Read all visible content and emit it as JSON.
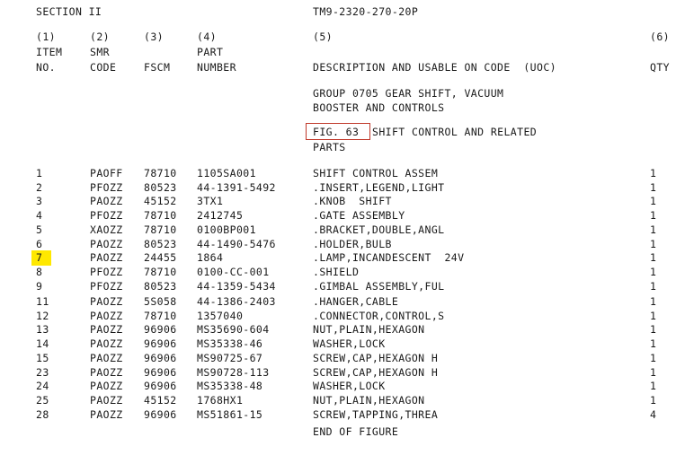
{
  "document": {
    "section_label": "SECTION II",
    "manual_number": "TM9-2320-270-20P"
  },
  "columns": {
    "numbers": [
      "(1)",
      "(2)",
      "(3)",
      "(4)",
      "(5)",
      "(6)"
    ],
    "item_line1": "ITEM",
    "item_line2": "NO.",
    "smr_line1": "SMR",
    "smr_line2": "CODE",
    "fscm": "FSCM",
    "part_line1": "PART",
    "part_line2": "NUMBER",
    "description": "DESCRIPTION AND USABLE ON CODE  (UOC)",
    "qty": "QTY"
  },
  "group": {
    "line1": "GROUP 0705 GEAR SHIFT, VACUUM",
    "line2": "BOOSTER AND CONTROLS"
  },
  "figure": {
    "label": "FIG. 63",
    "title_line1": "SHIFT CONTROL AND RELATED",
    "title_line2": "PARTS",
    "highlight_box_color": "#c0392b"
  },
  "highlight": {
    "row_item_no": "7",
    "color": "#ffe800"
  },
  "rows": [
    {
      "item": "1",
      "smr": "PAOFF",
      "fscm": "78710",
      "part": "1105SA001",
      "desc": "SHIFT CONTROL ASSEM",
      "qty": "1"
    },
    {
      "item": "2",
      "smr": "PFOZZ",
      "fscm": "80523",
      "part": "44-1391-5492",
      "desc": ".INSERT,LEGEND,LIGHT",
      "qty": "1"
    },
    {
      "item": "3",
      "smr": "PAOZZ",
      "fscm": "45152",
      "part": "3TX1",
      "desc": ".KNOB  SHIFT",
      "qty": "1"
    },
    {
      "item": "4",
      "smr": "PFOZZ",
      "fscm": "78710",
      "part": "2412745",
      "desc": ".GATE ASSEMBLY",
      "qty": "1"
    },
    {
      "item": "5",
      "smr": "XAOZZ",
      "fscm": "78710",
      "part": "0100BP001",
      "desc": ".BRACKET,DOUBLE,ANGL",
      "qty": "1"
    },
    {
      "item": "6",
      "smr": "PAOZZ",
      "fscm": "80523",
      "part": "44-1490-5476",
      "desc": ".HOLDER,BULB",
      "qty": "1"
    },
    {
      "item": "7",
      "smr": "PAOZZ",
      "fscm": "24455",
      "part": "1864",
      "desc": ".LAMP,INCANDESCENT  24V",
      "qty": "1"
    },
    {
      "item": "8",
      "smr": "PFOZZ",
      "fscm": "78710",
      "part": "0100-CC-001",
      "desc": ".SHIELD",
      "qty": "1"
    },
    {
      "item": "9",
      "smr": "PFOZZ",
      "fscm": "80523",
      "part": "44-1359-5434",
      "desc": ".GIMBAL ASSEMBLY,FUL",
      "qty": "1"
    },
    {
      "item": "11",
      "smr": "PAOZZ",
      "fscm": "5S058",
      "part": "44-1386-2403",
      "desc": ".HANGER,CABLE",
      "qty": "1"
    },
    {
      "item": "12",
      "smr": "PAOZZ",
      "fscm": "78710",
      "part": "1357040",
      "desc": ".CONNECTOR,CONTROL,S",
      "qty": "1"
    },
    {
      "item": "13",
      "smr": "PAOZZ",
      "fscm": "96906",
      "part": "MS35690-604",
      "desc": "NUT,PLAIN,HEXAGON",
      "qty": "1"
    },
    {
      "item": "14",
      "smr": "PAOZZ",
      "fscm": "96906",
      "part": "MS35338-46",
      "desc": "WASHER,LOCK",
      "qty": "1"
    },
    {
      "item": "15",
      "smr": "PAOZZ",
      "fscm": "96906",
      "part": "MS90725-67",
      "desc": "SCREW,CAP,HEXAGON H",
      "qty": "1"
    },
    {
      "item": "23",
      "smr": "PAOZZ",
      "fscm": "96906",
      "part": "MS90728-113",
      "desc": "SCREW,CAP,HEXAGON H",
      "qty": "1"
    },
    {
      "item": "24",
      "smr": "PAOZZ",
      "fscm": "96906",
      "part": "MS35338-48",
      "desc": "WASHER,LOCK",
      "qty": "1"
    },
    {
      "item": "25",
      "smr": "PAOZZ",
      "fscm": "45152",
      "part": "1768HX1",
      "desc": "NUT,PLAIN,HEXAGON",
      "qty": "1"
    },
    {
      "item": "28",
      "smr": "PAOZZ",
      "fscm": "96906",
      "part": "MS51861-15",
      "desc": "SCREW,TAPPING,THREA",
      "qty": "4"
    }
  ],
  "footer": {
    "end_of_figure": "END OF FIGURE"
  }
}
